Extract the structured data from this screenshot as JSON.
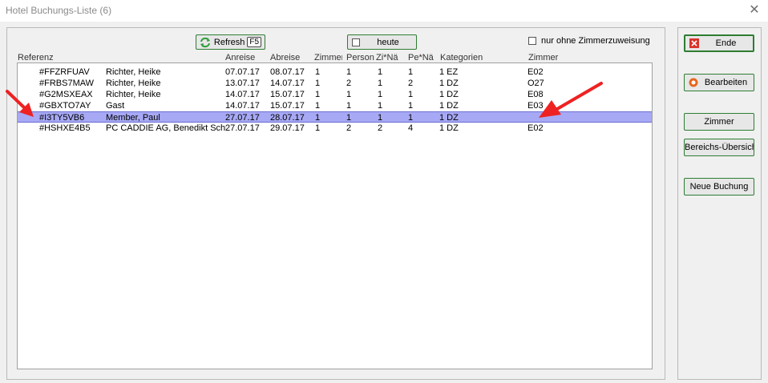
{
  "window": {
    "title": "Hotel Buchungs-Liste (6)"
  },
  "toolbar": {
    "refresh_label": "Refresh",
    "refresh_key": "F5",
    "heute_label": "heute",
    "filter_label": "nur ohne Zimmerzuweisung",
    "filter_checked": false
  },
  "table": {
    "columns": [
      "Referenz",
      "Anreise",
      "Abreise",
      "Zimmer",
      "Person",
      "Zi*Nä",
      "Pe*Nä",
      "Kategorien",
      "Zimmer"
    ],
    "rows": [
      {
        "ref": "#FFZRFUAV",
        "name": "Richter, Heike",
        "anreise": "07.07.17",
        "abreise": "08.07.17",
        "zimmer": "1",
        "person": "1",
        "zina": "1",
        "pena": "1",
        "kat": "1 EZ",
        "zim": "E02"
      },
      {
        "ref": "#FRBS7MAW",
        "name": "Richter, Heike",
        "anreise": "13.07.17",
        "abreise": "14.07.17",
        "zimmer": "1",
        "person": "2",
        "zina": "1",
        "pena": "2",
        "kat": "1 DZ",
        "zim": "O27"
      },
      {
        "ref": "#G2MSXEAX",
        "name": "Richter, Heike",
        "anreise": "14.07.17",
        "abreise": "15.07.17",
        "zimmer": "1",
        "person": "1",
        "zina": "1",
        "pena": "1",
        "kat": "1 DZ",
        "zim": "E08"
      },
      {
        "ref": "#GBXTO7AY",
        "name": "Gast",
        "anreise": "14.07.17",
        "abreise": "15.07.17",
        "zimmer": "1",
        "person": "1",
        "zina": "1",
        "pena": "1",
        "kat": "1 DZ",
        "zim": "E03"
      },
      {
        "ref": "#I3TY5VB6",
        "name": "Member, Paul",
        "anreise": "27.07.17",
        "abreise": "28.07.17",
        "zimmer": "1",
        "person": "1",
        "zina": "1",
        "pena": "1",
        "kat": "1 DZ",
        "zim": ""
      },
      {
        "ref": "#HSHXE4B5",
        "name": "PC CADDIE AG, Benedikt Schr",
        "anreise": "27.07.17",
        "abreise": "29.07.17",
        "zimmer": "1",
        "person": "2",
        "zina": "2",
        "pena": "4",
        "kat": "1 DZ",
        "zim": "E02"
      }
    ],
    "selected_row": 4
  },
  "side": {
    "ende_label": "Ende",
    "bearbeiten_label": "Bearbeiten",
    "zimmer_label": "Zimmer",
    "bereich_label": "Bereichs-Übersich",
    "neue_label": "Neue Buchung"
  },
  "colors": {
    "selection": "#a7a9f5",
    "annotation_arrow": "#ee2222",
    "button_border": "#2e7d32"
  },
  "icons": {
    "refresh": "refresh-icon",
    "ende": "exit-icon",
    "bearbeiten": "edit-icon",
    "close": "close-icon"
  }
}
